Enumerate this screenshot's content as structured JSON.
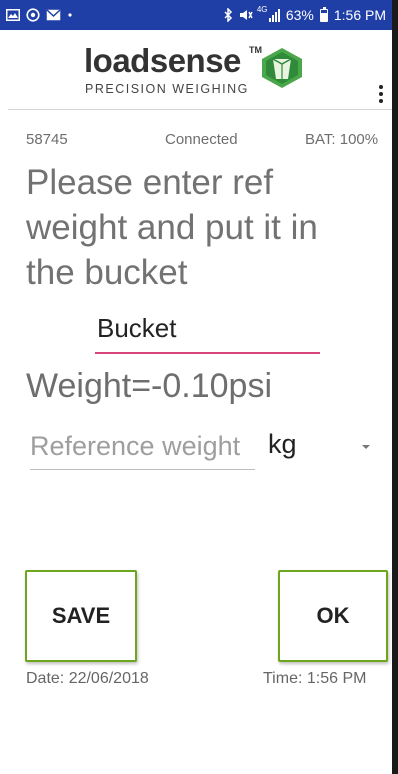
{
  "status_bar": {
    "battery_percent": "63%",
    "clock": "1:56 PM",
    "network_type": "4G",
    "background_color": "#1f3fa6",
    "icons": [
      "gallery-icon",
      "circle-app-icon",
      "mail-icon",
      "dot-icon",
      "bluetooth-icon",
      "mute-icon",
      "signal-icon",
      "battery-icon"
    ]
  },
  "header": {
    "logo_word": "loadsense",
    "logo_tm": "TM",
    "logo_subtitle": "PRECISION WEIGHING",
    "logo_color": "#3a9a3a",
    "menu_icon": "overflow-menu-icon"
  },
  "device": {
    "id": "58745",
    "connection_status": "Connected",
    "battery": "BAT: 100%"
  },
  "prompt": "Please enter ref weight and put it in the bucket",
  "bucket_field": {
    "value": "Bucket",
    "underline_color": "#d9447a"
  },
  "weight_display": "Weight=-0.10psi",
  "reference_input": {
    "placeholder": "Reference weight",
    "value": ""
  },
  "unit_select": {
    "selected": "kg"
  },
  "buttons": {
    "save": "SAVE",
    "ok": "OK",
    "border_color": "#6ea51e"
  },
  "footer": {
    "date": "Date: 22/06/2018",
    "time": "Time: 1:56 PM"
  }
}
